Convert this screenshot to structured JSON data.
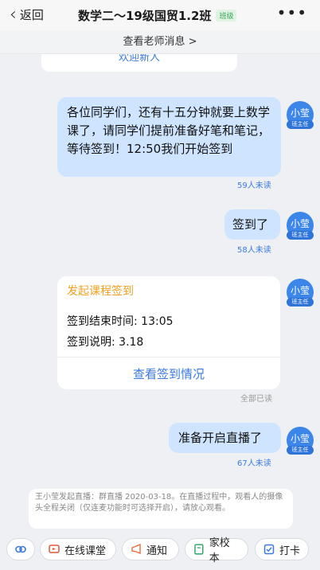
{
  "header": {
    "back_label": "返回",
    "title": "数学二～19级国贸1.2班",
    "tag": "班级",
    "more": "•••"
  },
  "teacher_messages_link": "查看老师消息 >",
  "welcome_partial": "欢迎新人",
  "messages": [
    {
      "text": "各位同学们，还有十五分钟就要上数学课了，请同学们提前准备好笔和笔记，等待签到！12:50我们开始签到",
      "status": "59人未读",
      "avatar_name": "小莹",
      "avatar_role": "班主任"
    },
    {
      "text": "签到了",
      "status": "58人未读",
      "avatar_name": "小莹",
      "avatar_role": "班主任"
    },
    {
      "card_title": "发起课程签到",
      "end_time": "签到结束时间: 13:05",
      "note": "签到说明: 3.18",
      "action": "查看签到情况",
      "status": "全部已读",
      "avatar_name": "小莹",
      "avatar_role": "班主任"
    },
    {
      "text": "准备开启直播了",
      "status": "67人未读",
      "avatar_name": "小莹",
      "avatar_role": "班主任"
    }
  ],
  "system_notice": "王小莹发起直播：群直播 2020-03-18。在直播过程中，观看人的摄像头全程关闭（仅连麦功能时可选择开启），请放心观看。",
  "toolbar": {
    "items": [
      {
        "label": "在线课堂",
        "icon": "classroom-icon"
      },
      {
        "label": "通知",
        "icon": "megaphone-icon"
      },
      {
        "label": "家校本",
        "icon": "notebook-icon"
      },
      {
        "label": "打卡",
        "icon": "checkin-icon"
      }
    ]
  },
  "colors": {
    "accent": "#3a7ae0",
    "bubble": "#cfe5ff",
    "card_title": "#f0a020"
  }
}
